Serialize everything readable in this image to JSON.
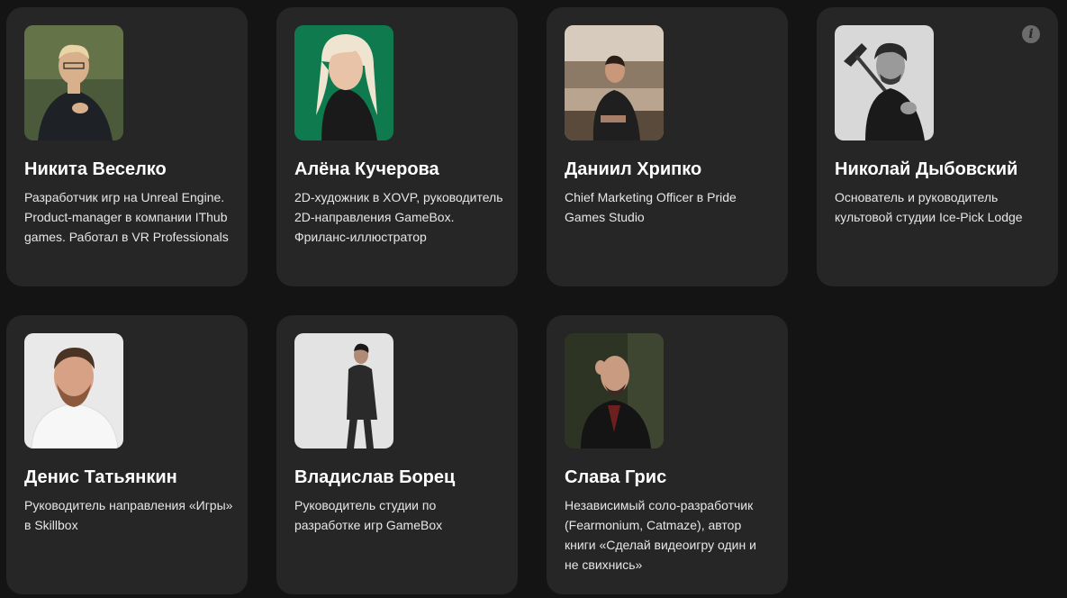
{
  "speakers": [
    {
      "name": "Никита Веселко",
      "description": "Разработчик игр на Unreal Engine. Product-manager в компании IThub games. Работал в VR Professionals",
      "photo_bg": "#4b5a3a",
      "photo_accent": "#1e2226",
      "photo_skin": "#d9b08c"
    },
    {
      "name": "Алёна Кучерова",
      "description": "2D-художник в XOVP, руководитель 2D-направления GameBox. Фриланс-иллюстратор",
      "photo_bg": "#0f7a4e",
      "photo_accent": "#1a1a1a",
      "photo_skin": "#e8c3a7"
    },
    {
      "name": "Даниил Хрипко",
      "description": "Chief Marketing Officer в Pride Games Studio",
      "photo_bg": "#b9a58f",
      "photo_accent": "#1f1f1f",
      "photo_skin": "#c9977a"
    },
    {
      "name": "Николай Дыбовский",
      "description": "Основатель и руководитель культовой студии Ice-Pick Lodge",
      "photo_bg": "#d8d8d8",
      "photo_accent": "#1a1a1a",
      "photo_skin": "#9a9a9a",
      "info_icon": "i"
    },
    {
      "name": "Денис Татьянкин",
      "description": "Руководитель направления «Игры» в Skillbox",
      "photo_bg": "#e9e9e9",
      "photo_accent": "#f4f4f4",
      "photo_skin": "#d6a184"
    },
    {
      "name": "Владислав Борец",
      "description": "Руководитель студии по разработке игр GameBox",
      "photo_bg": "#e3e3e3",
      "photo_accent": "#2a2a2a",
      "photo_skin": "#b08a74"
    },
    {
      "name": "Слава Грис",
      "description": "Независимый соло-разработчик (Fearmonium, Catmaze), автор книги «Сделай видеоигру один и не свихнись»",
      "photo_bg": "#2e3424",
      "photo_accent": "#141414",
      "photo_skin": "#c99b80"
    }
  ]
}
